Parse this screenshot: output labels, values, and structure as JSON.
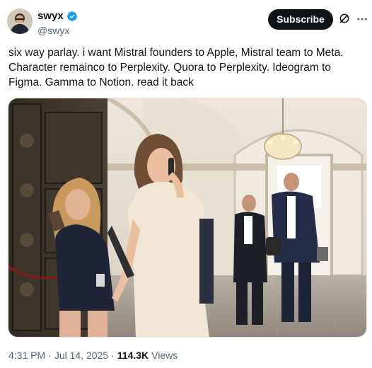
{
  "author": {
    "display_name": "swyx",
    "handle": "@swyx",
    "verified": true,
    "avatar_icon": "profile-photo"
  },
  "header": {
    "subscribe_label": "Subscribe",
    "grok_icon": "grok-icon",
    "more_icon": "more-options-icon"
  },
  "tweet": {
    "text": "six way parlay. i want Mistral founders to Apple, Mistral team to Meta. Character remainco to Perplexity. Quora  to Perplexity. Ideogram to Figma. Gamma to Notion. read it back"
  },
  "meta": {
    "time": "4:31 PM",
    "separator": "·",
    "date": "Jul 14, 2025",
    "views_count": "114.3K",
    "views_label": "Views"
  },
  "colors": {
    "text_primary": "#0f1419",
    "text_secondary": "#536471",
    "verified_blue": "#1d9bf0",
    "button_bg": "#0f1419"
  }
}
